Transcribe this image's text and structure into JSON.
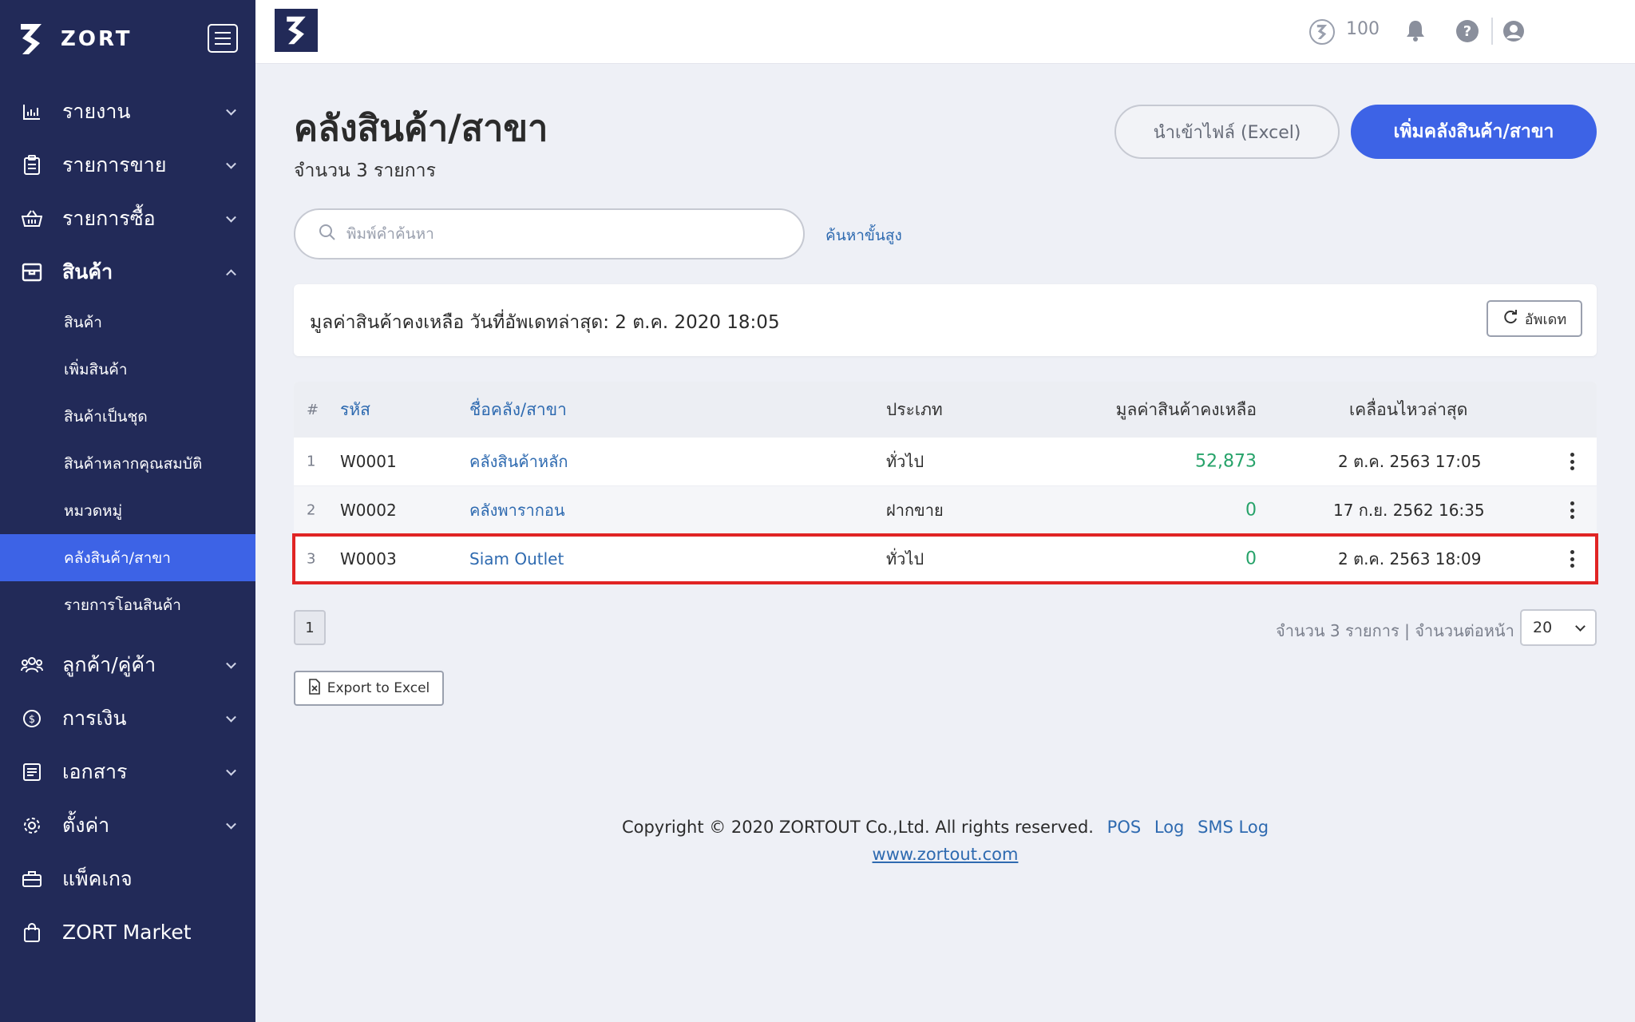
{
  "brand": {
    "name": "ZORT"
  },
  "sidebar": {
    "items": [
      {
        "label": "รายงาน",
        "icon": "bar-chart-icon",
        "expanded": false
      },
      {
        "label": "รายการขาย",
        "icon": "clipboard-icon",
        "expanded": false
      },
      {
        "label": "รายการซื้อ",
        "icon": "basket-icon",
        "expanded": false
      },
      {
        "label": "สินค้า",
        "icon": "box-icon",
        "expanded": true
      }
    ],
    "sub_items": [
      {
        "label": "สินค้า"
      },
      {
        "label": "เพิ่มสินค้า"
      },
      {
        "label": "สินค้าเป็นชุด"
      },
      {
        "label": "สินค้าหลากคุณสมบัติ"
      },
      {
        "label": "หมวดหมู่"
      },
      {
        "label": "คลังสินค้า/สาขา",
        "active": true
      },
      {
        "label": "รายการโอนสินค้า"
      }
    ],
    "items_after": [
      {
        "label": "ลูกค้า/คู่ค้า",
        "icon": "users-icon",
        "expanded": false
      },
      {
        "label": "การเงิน",
        "icon": "dollar-icon",
        "expanded": false
      },
      {
        "label": "เอกสาร",
        "icon": "document-icon",
        "expanded": false
      },
      {
        "label": "ตั้งค่า",
        "icon": "gear-icon",
        "expanded": false
      },
      {
        "label": "แพ็คเกจ",
        "icon": "briefcase-icon"
      },
      {
        "label": "ZORT Market",
        "icon": "shopping-bag-icon"
      }
    ]
  },
  "topbar": {
    "credits": "100"
  },
  "page": {
    "title": "คลังสินค้า/สาขา",
    "count": "จำนวน 3 รายการ",
    "import_button": "นำเข้าไฟล์ (Excel)",
    "add_button": "เพิ่มคลังสินค้า/สาขา"
  },
  "search": {
    "placeholder": "พิมพ์คำค้นหา",
    "advanced": "ค้นหาขั้นสูง"
  },
  "info": {
    "text": "มูลค่าสินค้าคงเหลือ วันที่อัพเดทล่าสุด: 2 ต.ค. 2020 18:05",
    "refresh_button": "อัพเดท"
  },
  "table": {
    "headers": {
      "num": "#",
      "code": "รหัส",
      "name": "ชื่อคลัง/สาขา",
      "type": "ประเภท",
      "value": "มูลค่าสินค้าคงเหลือ",
      "last_move": "เคลื่อนไหวล่าสุด"
    },
    "rows": [
      {
        "num": "1",
        "code": "W0001",
        "name": "คลังสินค้าหลัก",
        "type": "ทั่วไป",
        "value": "52,873",
        "last_move": "2 ต.ค. 2563 17:05"
      },
      {
        "num": "2",
        "code": "W0002",
        "name": "คลังพารากอน",
        "type": "ฝากขาย",
        "value": "0",
        "last_move": "17 ก.ย. 2562 16:35"
      },
      {
        "num": "3",
        "code": "W0003",
        "name": "Siam Outlet",
        "type": "ทั่วไป",
        "value": "0",
        "last_move": "2 ต.ค. 2563 18:09",
        "highlighted": true
      }
    ]
  },
  "pagination": {
    "current_page": "1",
    "info": "จำนวน 3 รายการ | จำนวนต่อหน้า",
    "per_page": "20"
  },
  "export_button": "Export to Excel",
  "footer": {
    "copyright": "Copyright © 2020 ZORTOUT Co.,Ltd. All rights reserved.",
    "links": [
      "POS",
      "Log",
      "SMS Log"
    ],
    "website": "www.zortout.com"
  },
  "colors": {
    "sidebar_bg": "#222a58",
    "accent": "#3d63e6",
    "link": "#2e6ab0",
    "positive": "#27a36a",
    "highlight": "#e02424"
  }
}
